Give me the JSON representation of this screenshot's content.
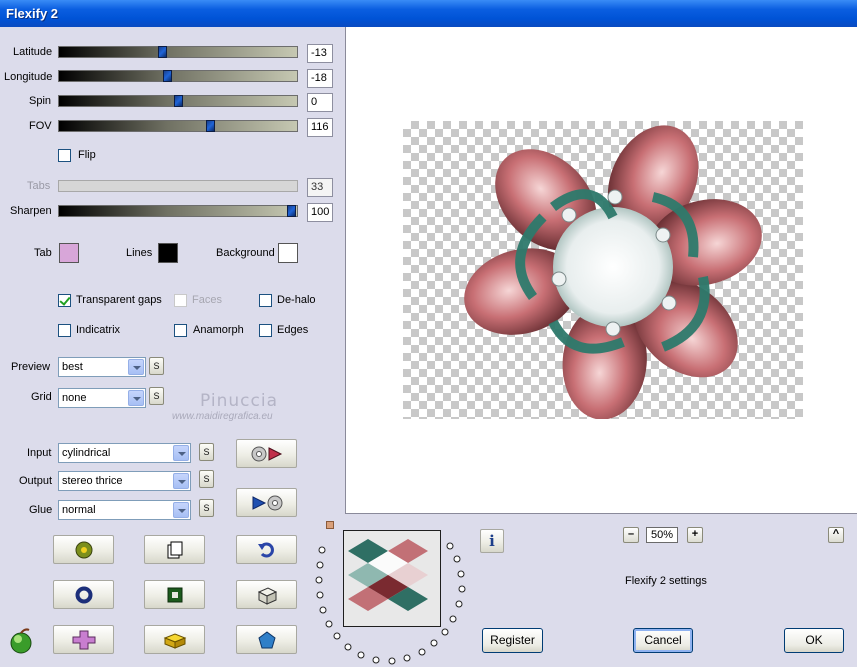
{
  "window": {
    "title": "Flexify 2"
  },
  "sliders": [
    {
      "label": "Latitude",
      "value": "-13",
      "position": 0.43,
      "disabled": false
    },
    {
      "label": "Longitude",
      "value": "-18",
      "position": 0.45,
      "disabled": false
    },
    {
      "label": "Spin",
      "value": "0",
      "position": 0.5,
      "disabled": false
    },
    {
      "label": "FOV",
      "value": "116",
      "position": 0.64,
      "disabled": false
    },
    {
      "label": "Tabs",
      "value": "33",
      "position": null,
      "disabled": true
    },
    {
      "label": "Sharpen",
      "value": "100",
      "position": 0.98,
      "disabled": false
    }
  ],
  "flip": {
    "label": "Flip",
    "checked": false
  },
  "colors": {
    "tab_label": "Tab",
    "tab_color": "#d8a6d9",
    "lines_label": "Lines",
    "lines_color": "#000000",
    "background_label": "Background",
    "background_color": "#ffffff"
  },
  "options": {
    "transparent_gaps": {
      "label": "Transparent gaps",
      "checked": true
    },
    "faces": {
      "label": "Faces",
      "checked": false,
      "disabled": true
    },
    "de_halo": {
      "label": "De-halo",
      "checked": false
    },
    "indicatrix": {
      "label": "Indicatrix",
      "checked": false
    },
    "anamorph": {
      "label": "Anamorph",
      "checked": false
    },
    "edges": {
      "label": "Edges",
      "checked": false
    }
  },
  "selects": {
    "preview": {
      "label": "Preview",
      "value": "best"
    },
    "grid": {
      "label": "Grid",
      "value": "none"
    },
    "input": {
      "label": "Input",
      "value": "cylindrical"
    },
    "output": {
      "label": "Output",
      "value": "stereo thrice"
    },
    "glue": {
      "label": "Glue",
      "value": "normal"
    }
  },
  "small_button_label": "S",
  "watermark": {
    "line1": "Pinuccia",
    "line2": "www.maidiregrafica.eu"
  },
  "zoom": {
    "value": "50%",
    "minus": "–",
    "plus": "+"
  },
  "scroll_up": "^",
  "info_button": "i",
  "settings_caption": "Flexify 2 settings",
  "buttons": {
    "register": "Register",
    "cancel": "Cancel",
    "ok": "OK"
  }
}
